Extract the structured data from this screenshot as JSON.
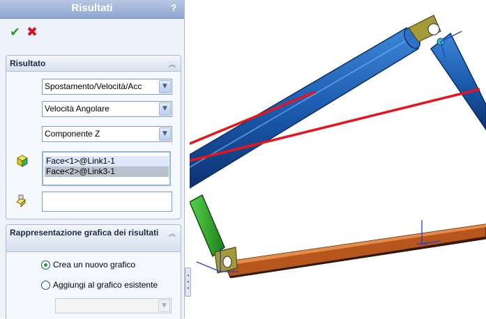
{
  "panel": {
    "title": "Risultati",
    "help_label": "?",
    "ok_label": "✔",
    "cancel_label": "✖",
    "result_group": {
      "title": "Risultato",
      "category": "Spostamento/Velocità/Acc",
      "subcategory": "Velocità Angolare",
      "component": "Componente Z",
      "selected_faces": [
        "Face<1>@Link1-1",
        "Face<2>@Link3-1"
      ],
      "reference_value": ""
    },
    "plot_group": {
      "title": "Rappresentazione grafica dei risultati",
      "options": [
        {
          "label": "Crea un nuovo grafico",
          "selected": true
        },
        {
          "label": "Aggiungi al grafico esistente",
          "selected": false
        }
      ],
      "existing_plot_value": ""
    },
    "collapse_icon": "double-chevron-up-icon",
    "colors": {
      "ok": "#2f9a24",
      "cancel": "#d3141a",
      "header": "#8ea6cf"
    }
  },
  "viewport": {
    "parts": [
      "blue-link-top",
      "blue-link-right",
      "green-link",
      "orange-link"
    ],
    "annotation_color": "#e8131b"
  }
}
